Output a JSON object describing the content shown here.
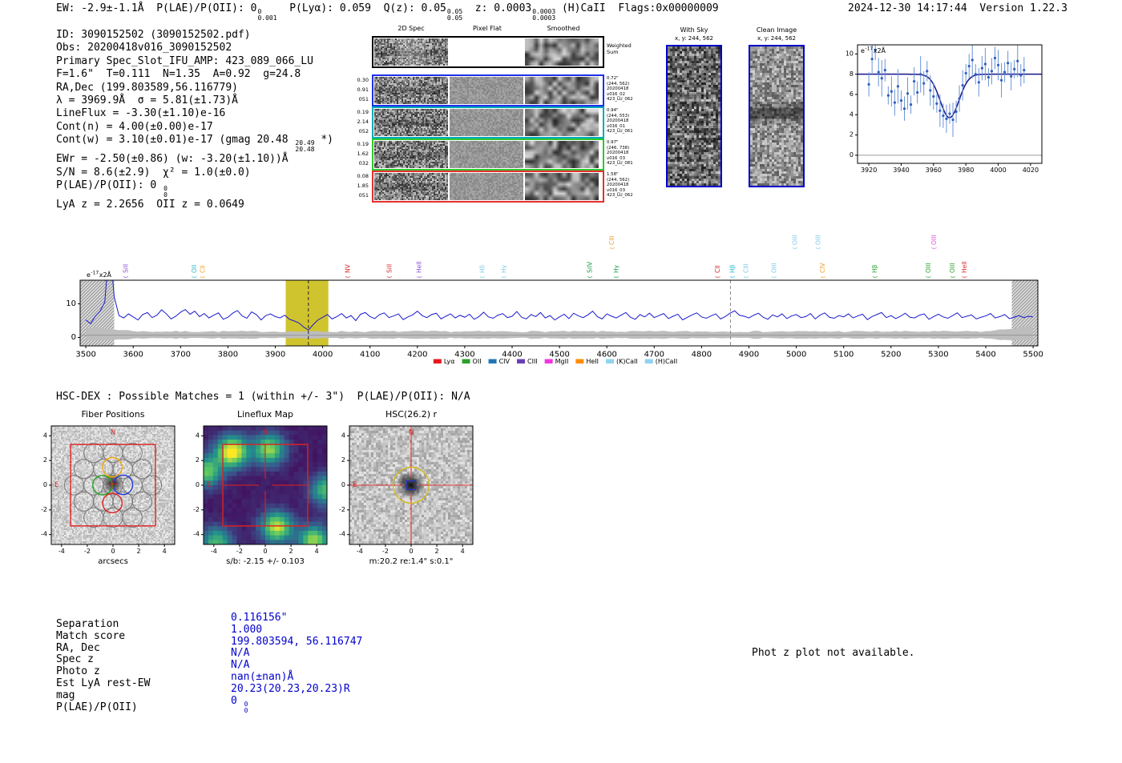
{
  "header": {
    "parts": [
      {
        "text": "EW: -2.9±-1.1Å  P(LAE)/P(OII): 0"
      },
      {
        "sup": "0",
        "sub": "0.001"
      },
      {
        "text": "  P(Lyα): 0.059  Q(z): 0.05"
      },
      {
        "sup": "0.05",
        "sub": "0.05"
      },
      {
        "text": "  z: 0.0003"
      },
      {
        "sup": "0.0003",
        "sub": "0.0003"
      },
      {
        "text": " (H)CaII  Flags:0x00000009"
      }
    ],
    "timestamp": "2024-12-30 14:17:44",
    "version": "Version 1.22.3"
  },
  "info_block": {
    "lines": [
      [
        {
          "text": "ID: 3090152502 (3090152502.pdf)"
        }
      ],
      [
        {
          "text": "Obs: 20200418v016_3090152502"
        }
      ],
      [
        {
          "text": "Primary Spec_Slot_IFU_AMP: 423_089_066_LU"
        }
      ],
      [
        {
          "text": "F=1.6\"  T=0.111  N=1.35  A=0.92  g=24.8"
        }
      ],
      [
        {
          "text": "RA,Dec (199.803589,56.116779)"
        }
      ],
      [
        {
          "text": "λ = 3969.9Å  σ = 5.81(±1.73)Å"
        }
      ],
      [
        {
          "text": "LineFlux = -3.30(±1.10)e-16"
        }
      ],
      [
        {
          "text": "Cont(n) = 4.00(±0.00)e-17"
        }
      ],
      [
        {
          "text": "Cont(w) = 3.10(±0.01)e-17 (gmag 20.48 "
        },
        {
          "sup": "20.49",
          "sub": "20.48"
        },
        {
          "text": " *)"
        }
      ],
      [
        {
          "text": "EWr = -2.50(±0.86) (w: -3.20(±1.10))Å"
        }
      ],
      [
        {
          "text": "S/N = 8.6(±2.9)  χ² = 1.0(±0.0)"
        }
      ],
      [
        {
          "text": "P(LAE)/P(OII): 0 "
        },
        {
          "sup": "0",
          "sub": "0"
        }
      ],
      [
        {
          "text": "LyA z = 2.2656  OII z = 0.0649"
        }
      ]
    ]
  },
  "spec2d": {
    "col_headers": [
      "2D Spec",
      "Pixel Flat",
      "Smoothed"
    ],
    "rows": [
      {
        "border": "#000000",
        "left_label": [],
        "right_label": [
          "Weighted",
          "Sum"
        ]
      },
      {
        "border": "#1f2fe8",
        "left_label": [
          "0.30",
          "0.91",
          "051"
        ],
        "right_label": [
          "0.72\"",
          "(244, 562)",
          "20200418",
          "v016_02",
          "423_LU_062"
        ]
      },
      {
        "border": "#00aab8",
        "left_label": [
          "0.19",
          "2.14",
          "052"
        ],
        "right_label": [
          "0.94\"",
          "(244, 553)",
          "20200418",
          "v016_01",
          "423_LU_061"
        ]
      },
      {
        "border": "#2ec82e",
        "left_label": [
          "0.19",
          "1.62",
          "032"
        ],
        "right_label": [
          "0.97\"",
          "(246, 738)",
          "20200418",
          "v016_03",
          "423_LU_081"
        ]
      },
      {
        "border": "#e82e2e",
        "left_label": [
          "0.08",
          "1.85",
          "051"
        ],
        "right_label": [
          "1.58\"",
          "(244, 562)",
          "20200418",
          "v016_03",
          "423_LU_062"
        ]
      }
    ]
  },
  "sky_panels": [
    {
      "title": "With Sky",
      "coords": "x, y: 244, 562"
    },
    {
      "title": "Clean Image",
      "coords": "x, y: 244, 562"
    }
  ],
  "matches_line": "HSC-DEX : Possible Matches = 1 (within +/- 3\")  P(LAE)/P(OII): N/A",
  "cutouts": {
    "panels": [
      {
        "title": "Fiber Positions",
        "xlabel": "arcsecs",
        "ticks": [
          -4,
          -2,
          0,
          2,
          4
        ],
        "compass": {
          "n": "N",
          "e": "E"
        }
      },
      {
        "title": "Lineflux Map",
        "xlabel": "s/b: -2.15 +/- 0.103",
        "ticks": [
          -4,
          -2,
          0,
          2,
          4
        ],
        "compass": {
          "n": "N",
          "e": "E"
        }
      },
      {
        "title": "HSC(26.2) r",
        "xlabel": "m:20.2 re:1.4\" s:0.1\"",
        "ticks": [
          -4,
          -2,
          0,
          2,
          4
        ],
        "compass": {
          "n": "N",
          "e": "E"
        }
      }
    ]
  },
  "match_table": {
    "rows": [
      {
        "label": "Separation",
        "value_parts": [
          {
            "text": "0.116156\""
          }
        ]
      },
      {
        "label": "Match score",
        "value_parts": [
          {
            "text": "1.000"
          }
        ]
      },
      {
        "label": "RA, Dec",
        "value_parts": [
          {
            "text": "199.803594, 56.116747"
          }
        ]
      },
      {
        "label": "Spec z",
        "value_parts": [
          {
            "text": "N/A"
          }
        ]
      },
      {
        "label": "Photo z",
        "value_parts": [
          {
            "text": "N/A"
          }
        ]
      },
      {
        "label": "Est LyA rest-EW",
        "value_parts": [
          {
            "text": "nan(±nan)Å"
          }
        ]
      },
      {
        "label": "mag",
        "value_parts": [
          {
            "text": "20.23(20.23,20.23)R"
          }
        ]
      },
      {
        "label": "P(LAE)/P(OII)",
        "value_parts": [
          {
            "text": "0 "
          },
          {
            "sup": "0",
            "sub": "0"
          }
        ]
      }
    ]
  },
  "photz_note": "Phot z plot not available.",
  "chart_data": [
    {
      "id": "emission_line_fit",
      "type": "scatter",
      "title": "",
      "scale_label": {
        "prefix": "e",
        "exp": "-17",
        "suffix": "x2Å"
      },
      "xlim": [
        3913,
        4027
      ],
      "ylim": [
        -0.8,
        10.9
      ],
      "x_ticks": [
        3920,
        3940,
        3960,
        3980,
        4000,
        4020
      ],
      "y_ticks": [
        0,
        2,
        4,
        6,
        8,
        10
      ],
      "x": [
        3920,
        3922,
        3924,
        3926,
        3928,
        3930,
        3932,
        3934,
        3936,
        3938,
        3940,
        3942,
        3944,
        3946,
        3948,
        3950,
        3952,
        3954,
        3956,
        3958,
        3960,
        3962,
        3964,
        3966,
        3968,
        3970,
        3972,
        3974,
        3976,
        3978,
        3980,
        3982,
        3984,
        3986,
        3988,
        3990,
        3992,
        3994,
        3996,
        3998,
        4000,
        4002,
        4004,
        4006,
        4008,
        4010,
        4012,
        4014,
        4016
      ],
      "y": [
        7.0,
        9.5,
        10.4,
        8.2,
        7.6,
        8.4,
        5.9,
        6.3,
        5.2,
        6.8,
        5.4,
        4.6,
        6.1,
        5.0,
        7.3,
        6.2,
        8.0,
        7.1,
        8.3,
        6.4,
        5.8,
        5.1,
        4.4,
        3.9,
        3.6,
        4.1,
        3.5,
        4.3,
        5.6,
        6.9,
        8.1,
        8.8,
        9.4,
        8.0,
        7.2,
        8.6,
        9.0,
        7.7,
        8.3,
        9.6,
        8.9,
        7.4,
        8.2,
        9.1,
        7.8,
        8.5,
        9.3,
        7.9,
        8.4
      ],
      "yerr": [
        1.2,
        1.6,
        1.0,
        1.4,
        1.8,
        1.1,
        0.9,
        1.5,
        1.3,
        1.7,
        1.0,
        1.2,
        1.6,
        0.9,
        1.4,
        1.1,
        1.8,
        1.2,
        1.0,
        1.5,
        1.3,
        0.9,
        1.6,
        1.2,
        1.4,
        1.0,
        1.7,
        1.1,
        1.3,
        1.5,
        0.9,
        1.2,
        1.8,
        1.0,
        1.4,
        1.2,
        1.6,
        0.9,
        1.3,
        1.1,
        1.5,
        1.7,
        1.0,
        1.2,
        1.4,
        0.9,
        1.6,
        1.1,
        1.3
      ],
      "fit_continuum": 8.0,
      "fit_center": 3969.9,
      "fit_sigma": 5.81,
      "fit_depth": 4.3
    },
    {
      "id": "full_spectrum",
      "type": "line",
      "scale_label": {
        "prefix": "e",
        "exp": "-17",
        "suffix": "x2Å"
      },
      "line_color": "#1a1acf",
      "xlim": [
        3488,
        5510
      ],
      "ylim": [
        -2.5,
        17
      ],
      "x_start": 3500,
      "x_step": 10,
      "x_ticks": [
        3500,
        3600,
        3700,
        3800,
        3900,
        4000,
        4100,
        4200,
        4300,
        4400,
        4500,
        4600,
        4700,
        4800,
        4900,
        5000,
        5100,
        5200,
        5300,
        5400,
        5500
      ],
      "y_ticks": [
        0,
        10
      ],
      "highlight_band": [
        3922,
        4012
      ],
      "dashed_lines": [
        3969.9,
        4861
      ],
      "hatch_regions": [
        [
          3488,
          3560
        ],
        [
          5455,
          5510
        ]
      ],
      "values": [
        5.2,
        4.1,
        6.3,
        7.8,
        10.5,
        28.0,
        12.0,
        6.5,
        5.8,
        7.0,
        6.1,
        5.2,
        6.8,
        7.4,
        5.9,
        6.6,
        8.2,
        7.0,
        5.5,
        6.3,
        7.5,
        8.3,
        6.9,
        7.8,
        6.2,
        7.1,
        5.8,
        6.6,
        7.3,
        5.4,
        6.0,
        7.2,
        8.0,
        6.4,
        5.7,
        7.6,
        6.8,
        5.2,
        6.5,
        7.0,
        6.2,
        5.8,
        6.6,
        5.4,
        4.9,
        4.3,
        3.1,
        2.2,
        3.8,
        5.2,
        6.0,
        6.8,
        5.5,
        6.2,
        7.1,
        5.8,
        6.5,
        5.0,
        6.9,
        7.4,
        6.2,
        5.6,
        6.8,
        7.3,
        5.9,
        6.4,
        7.0,
        5.3,
        6.1,
        6.7,
        7.8,
        6.5,
        5.9,
        6.8,
        7.2,
        5.5,
        6.3,
        7.0,
        5.8,
        6.6,
        6.0,
        6.9,
        5.4,
        6.2,
        7.5,
        6.1,
        5.7,
        6.6,
        7.1,
        5.9,
        6.3,
        7.7,
        6.0,
        5.5,
        6.8,
        6.2,
        7.4,
        5.8,
        6.5,
        5.2,
        6.1,
        6.9,
        5.6,
        7.2,
        6.4,
        5.9,
        6.7,
        7.8,
        6.2,
        5.5,
        7.0,
        6.3,
        5.8,
        6.6,
        7.4,
        6.0,
        5.4,
        6.8,
        6.1,
        7.2,
        5.9,
        6.5,
        7.1,
        5.6,
        6.3,
        6.9,
        5.2,
        6.0,
        6.7,
        7.3,
        6.1,
        5.7,
        6.4,
        7.0,
        5.5,
        6.2,
        7.2,
        7.9,
        6.6,
        6.3,
        5.8,
        6.6,
        7.2,
        6.0,
        5.4,
        6.7,
        6.1,
        7.0,
        5.6,
        6.4,
        6.8,
        5.9,
        6.2,
        7.1,
        5.5,
        6.6,
        7.3,
        6.0,
        5.7,
        6.5,
        6.1,
        7.0,
        5.8,
        6.4,
        6.9,
        5.3,
        6.2,
        6.8,
        7.4,
        5.9,
        6.5,
        5.6,
        6.3,
        7.2,
        6.0,
        5.8,
        6.6,
        7.0,
        5.4,
        6.2,
        6.9,
        6.1,
        5.7,
        6.5,
        7.3,
        5.9,
        6.3,
        6.7,
        5.5,
        6.0,
        6.4,
        7.1,
        5.8,
        6.2,
        6.8,
        5.6,
        6.0,
        6.5,
        5.9,
        6.3,
        6.1
      ],
      "line_labels": [
        {
          "name": "SiII",
          "wave": 3585,
          "color": "#8a4fd0",
          "tier": 0
        },
        {
          "name": "OII",
          "wave": 3730,
          "color": "#2ab5c9",
          "tier": 0
        },
        {
          "name": "CII",
          "wave": 3748,
          "color": "#f0a030",
          "tier": 0
        },
        {
          "name": "NV",
          "wave": 4054,
          "color": "#d62728",
          "tier": 0
        },
        {
          "name": "SiII",
          "wave": 4142,
          "color": "#d62728",
          "tier": 0
        },
        {
          "name": "HeII",
          "wave": 4205,
          "color": "#8a4fd0",
          "tier": 0
        },
        {
          "name": "Hδ",
          "wave": 4338,
          "color": "#7ec8e8",
          "tier": 0
        },
        {
          "name": "Hγ",
          "wave": 4384,
          "color": "#7ec8e8",
          "tier": 0
        },
        {
          "name": "SiIV",
          "wave": 4565,
          "color": "#1f9b46",
          "tier": 0
        },
        {
          "name": "CIII",
          "wave": 4612,
          "color": "#f0a030",
          "tier": 1
        },
        {
          "name": "Hγ",
          "wave": 4621,
          "color": "#1f9b46",
          "tier": 0
        },
        {
          "name": "CII",
          "wave": 4835,
          "color": "#d62728",
          "tier": 0
        },
        {
          "name": "Hβ",
          "wave": 4866,
          "color": "#2ab5c9",
          "tier": 0
        },
        {
          "name": "CIII",
          "wave": 4895,
          "color": "#7ec8e8",
          "tier": 0
        },
        {
          "name": "OIII",
          "wave": 4954,
          "color": "#7ec8e8",
          "tier": 0
        },
        {
          "name": "OIII",
          "wave": 4998,
          "color": "#7ec8e8",
          "tier": 1
        },
        {
          "name": "OIII",
          "wave": 5047,
          "color": "#7ec8e8",
          "tier": 1
        },
        {
          "name": "CIV",
          "wave": 5057,
          "color": "#f0a030",
          "tier": 0
        },
        {
          "name": "Hβ",
          "wave": 5167,
          "color": "#2ca02c",
          "tier": 0
        },
        {
          "name": "OIII",
          "wave": 5280,
          "color": "#2ca02c",
          "tier": 0
        },
        {
          "name": "OIII",
          "wave": 5292,
          "color": "#e350d8",
          "tier": 1
        },
        {
          "name": "OIII",
          "wave": 5331,
          "color": "#2ca02c",
          "tier": 0
        },
        {
          "name": "HeII",
          "wave": 5356,
          "color": "#d62728",
          "tier": 0
        }
      ],
      "legend": [
        {
          "label": "Lyα",
          "color": "#e41a1c"
        },
        {
          "label": "OII",
          "color": "#2ca02c"
        },
        {
          "label": "CIV",
          "color": "#1f77b4"
        },
        {
          "label": "CIII",
          "color": "#6a3fb5"
        },
        {
          "label": "MgII",
          "color": "#f035e0"
        },
        {
          "label": "HeII",
          "color": "#ff8c00"
        },
        {
          "label": "(K)CaII",
          "color": "#8fd4f0"
        },
        {
          "label": "(H)CaII",
          "color": "#8fd4f0"
        }
      ]
    }
  ]
}
